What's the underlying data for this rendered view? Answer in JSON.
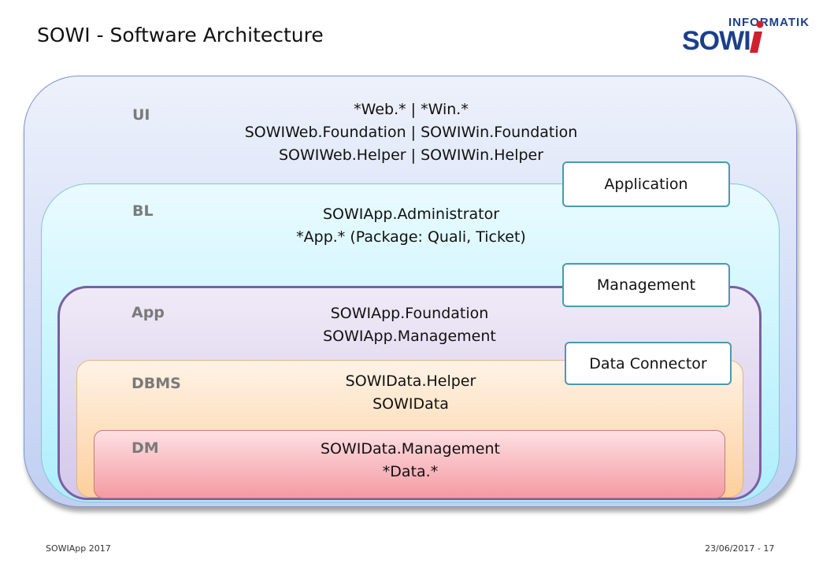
{
  "title": "SOWI - Software Architecture",
  "logo": {
    "top": "INFORMATIK",
    "main": "SOWI"
  },
  "layers": {
    "ui": {
      "label": "UI",
      "lines": [
        "*Web.* | *Win.*",
        "SOWIWeb.Foundation | SOWIWin.Foundation",
        "SOWIWeb.Helper | SOWIWin.Helper"
      ]
    },
    "bl": {
      "label": "BL",
      "lines": [
        "SOWIApp.Administrator",
        "*App.* (Package: Quali, Ticket)"
      ]
    },
    "app": {
      "label": "App",
      "lines": [
        "SOWIApp.Foundation",
        "SOWIApp.Management"
      ]
    },
    "dbms": {
      "label": "DBMS",
      "lines": [
        "SOWIData.Helper",
        "SOWIData"
      ]
    },
    "dm": {
      "label": "DM",
      "lines": [
        "SOWIData.Management",
        "*Data.*"
      ]
    }
  },
  "tags": {
    "application": "Application",
    "management": "Management",
    "data_connector": "Data Connector"
  },
  "footer": {
    "left": "SOWIApp 2017",
    "right": "23/06/2017 - 17"
  },
  "colors": {
    "ui": "#c0cff2",
    "bl": "#aeeefc",
    "app": "#d3c8ea",
    "dbms": "#fdcf9c",
    "dm": "#f49aa2",
    "tag_border": "#4a9ab0",
    "logo_blue": "#1b3f8a",
    "logo_red": "#d0202e"
  }
}
